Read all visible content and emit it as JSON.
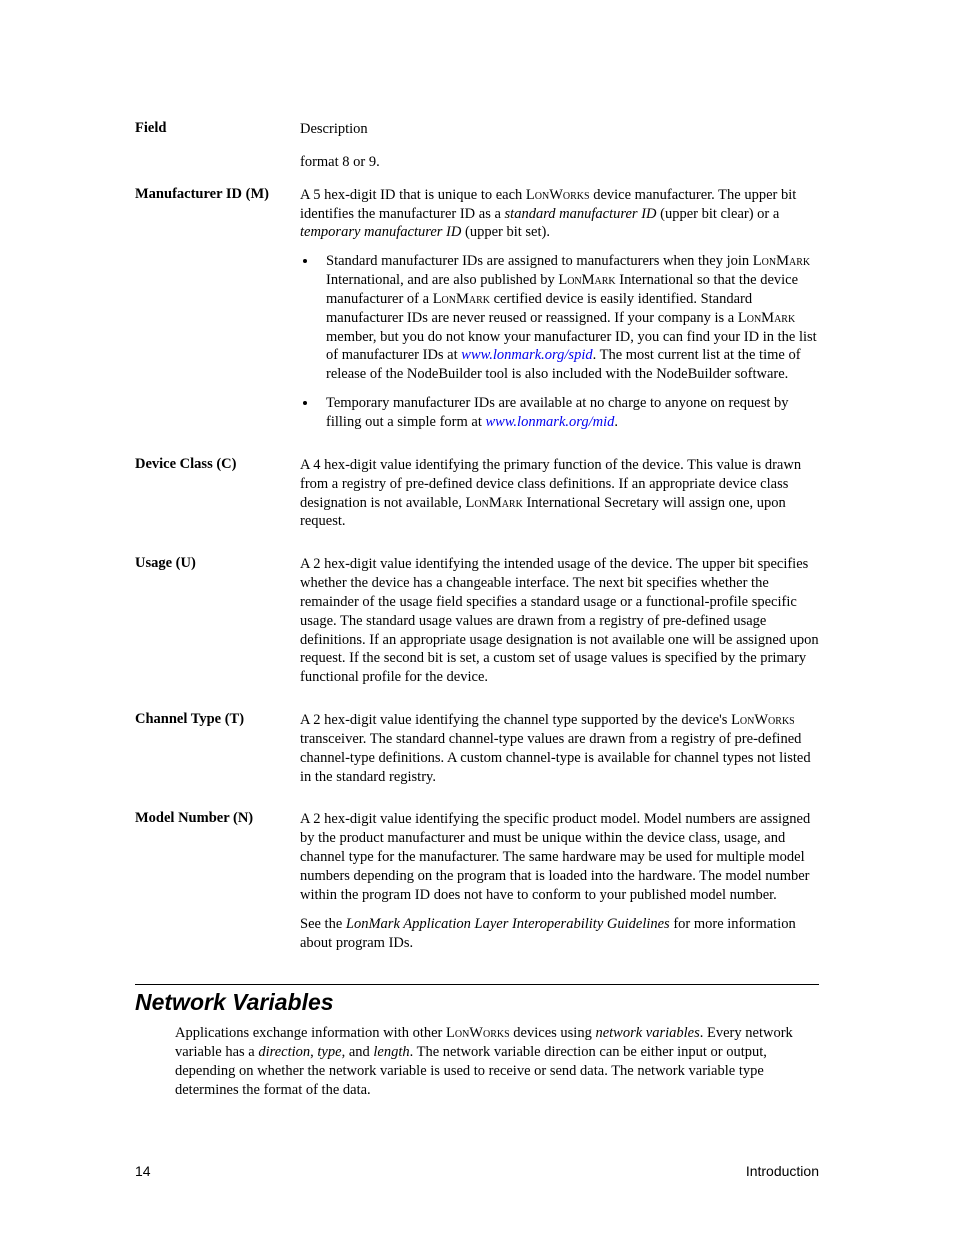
{
  "table": {
    "header": {
      "field": "Field",
      "description": "Description"
    },
    "format_carry": "format 8 or 9.",
    "rows": [
      {
        "field": "Manufacturer ID (M)",
        "intro_1": "A 5 hex-digit ID that is unique to each ",
        "intro_sc1": "LonWorks",
        "intro_2": " device manufacturer.  The upper bit identifies the manufacturer ID as a ",
        "intro_em1": "standard manufacturer ID",
        "intro_3": " (upper bit clear) or a ",
        "intro_em2": "temporary manufacturer ID",
        "intro_4": " (upper bit set).",
        "bullet1_a": "Standard manufacturer IDs are assigned to manufacturers when they join ",
        "bullet1_sc1": "LonMark",
        "bullet1_b": " International, and are also published by ",
        "bullet1_sc2": "LonMark",
        "bullet1_c": " International so that the device manufacturer of a ",
        "bullet1_sc3": "LonMark",
        "bullet1_d": " certified device is easily identified.  Standard manufacturer IDs are never reused or reassigned.  If your company is a ",
        "bullet1_sc4": "LonMark",
        "bullet1_e": " member, but you do not know your manufacturer ID, you can find your ID in the list of manufacturer IDs at ",
        "bullet1_link": "www.lonmark.org/spid",
        "bullet1_f": ".  The most current list at the time of release of the NodeBuilder tool is also included with the NodeBuilder software.",
        "bullet2_a": "Temporary manufacturer IDs are available at no charge to anyone on request by filling out a simple form at ",
        "bullet2_link": "www.lonmark.org/mid",
        "bullet2_b": "."
      },
      {
        "field": "Device Class (C)",
        "p1_a": "A 4 hex-digit value identifying the primary function of the device.  This value is drawn from a registry of pre-defined device class definitions.  If an appropriate device class designation is not available, ",
        "p1_sc": "LonMark",
        "p1_b": " International Secretary will assign one, upon request."
      },
      {
        "field": "Usage (U)",
        "p1": "A 2 hex-digit value identifying the intended usage of the device.  The upper bit specifies whether the device has a changeable interface.  The next bit specifies whether the remainder of the usage field specifies a standard usage or a functional-profile specific usage.  The standard usage values are drawn from a registry of pre-defined usage definitions.  If an appropriate usage designation is not available one will be assigned upon request.  If the second bit is set, a custom set of usage values is specified by the primary functional profile for the device."
      },
      {
        "field": "Channel Type (T)",
        "p1_a": "A 2 hex-digit value identifying the channel type supported by the device's ",
        "p1_sc": "LonWorks",
        "p1_b": " transceiver.  The standard channel-type values are drawn from a registry of pre-defined channel-type definitions.  A custom channel-type is available for channel types not listed in the standard registry."
      },
      {
        "field": "Model Number (N)",
        "p1": "A 2 hex-digit value identifying the specific product model.  Model numbers are assigned by the product manufacturer and must be unique within the device class, usage, and channel type for the manufacturer.  The same hardware may be used for multiple model numbers depending on the program that is loaded into the hardware.  The model number within the program ID does not have to conform to your published model number.",
        "p2_a": "See the ",
        "p2_em": "LonMark Application Layer Interoperability Guidelines",
        "p2_b": " for more information about program IDs."
      }
    ]
  },
  "section": {
    "title": "Network Variables",
    "para_a": "Applications exchange information with other ",
    "para_sc": "LonWorks",
    "para_b": " devices using ",
    "para_em1": "network variables",
    "para_c": ".  Every network variable has a ",
    "para_em2": "direction",
    "para_d": ", ",
    "para_em3": "type",
    "para_e": ", and ",
    "para_em4": "length",
    "para_f": ".  The network variable direction can be either input or output, depending on whether the network variable is used to receive or send data.  The network variable type determines the format of the data."
  },
  "footer": {
    "page": "14",
    "chapter": "Introduction"
  }
}
